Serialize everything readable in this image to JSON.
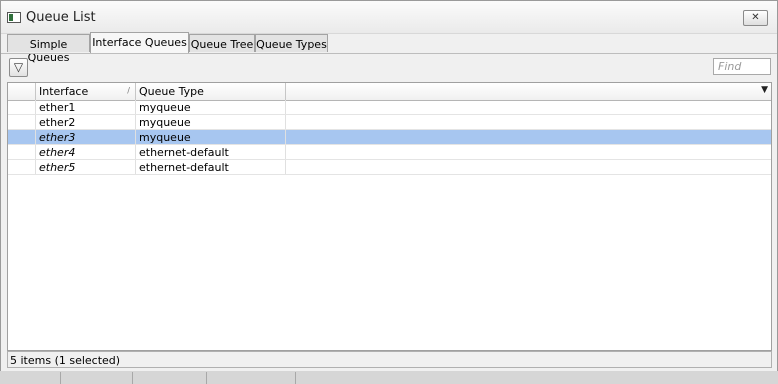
{
  "window": {
    "title": "Queue List",
    "close_glyph": "✕",
    "icon": "window-icon"
  },
  "tabs": [
    {
      "label": "Simple Queues",
      "active": false
    },
    {
      "label": "Interface Queues",
      "active": true
    },
    {
      "label": "Queue Tree",
      "active": false
    },
    {
      "label": "Queue Types",
      "active": false
    }
  ],
  "toolbar": {
    "filter_icon": "filter-icon",
    "filter_glyph": "▽",
    "find_placeholder": "Find"
  },
  "table": {
    "columns": [
      "Interface",
      "Queue Type",
      ""
    ],
    "sort_glyph": "/",
    "menu_glyph": "▼",
    "rows": [
      {
        "interface": "ether1",
        "queue_type": "myqueue",
        "selected": false,
        "italic": false
      },
      {
        "interface": "ether2",
        "queue_type": "myqueue",
        "selected": false,
        "italic": false
      },
      {
        "interface": "ether3",
        "queue_type": "myqueue",
        "selected": true,
        "italic": true
      },
      {
        "interface": "ether4",
        "queue_type": "ethernet-default",
        "selected": false,
        "italic": true
      },
      {
        "interface": "ether5",
        "queue_type": "ethernet-default",
        "selected": false,
        "italic": true
      }
    ]
  },
  "status": {
    "text": "5 items (1 selected)"
  },
  "colors": {
    "selection": "#a7c6f0",
    "window_bg": "#f0f0f0"
  }
}
